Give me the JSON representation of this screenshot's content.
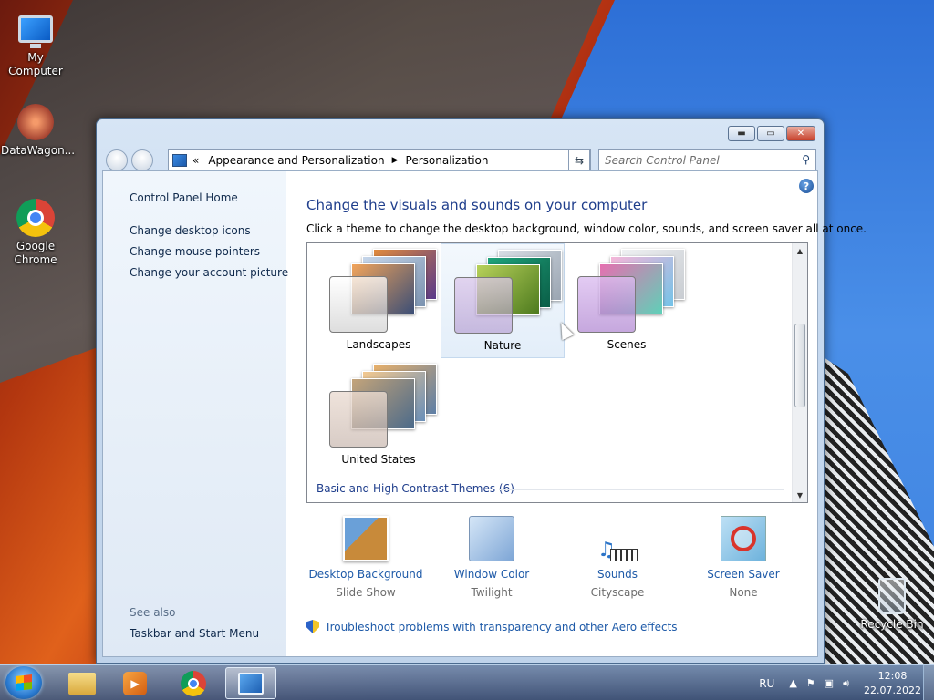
{
  "desktop": {
    "icons": [
      {
        "label": "My Computer",
        "icon": "computer-icon"
      },
      {
        "label": "DataWagon...",
        "icon": "datawagon-icon"
      },
      {
        "label": "Google Chrome",
        "icon": "chrome-icon"
      },
      {
        "label": "Recycle Bin",
        "icon": "recycle-bin-icon"
      }
    ]
  },
  "window": {
    "address": {
      "prefix": "«",
      "crumb1": "Appearance and Personalization",
      "crumb2": "Personalization"
    },
    "search_placeholder": "Search Control Panel",
    "sidebar": {
      "home": "Control Panel Home",
      "links": [
        "Change desktop icons",
        "Change mouse pointers",
        "Change your account picture"
      ],
      "see_also": "See also",
      "see_also_links": [
        "Taskbar and Start Menu"
      ]
    },
    "main": {
      "title": "Change the visuals and sounds on your computer",
      "subtitle": "Click a theme to change the desktop background, window color, sounds, and screen saver all at once.",
      "themes": [
        {
          "name": "Landscapes",
          "selected": false
        },
        {
          "name": "Nature",
          "selected": true
        },
        {
          "name": "Scenes",
          "selected": false
        },
        {
          "name": "United States",
          "selected": false
        }
      ],
      "group_header": "Basic and High Contrast Themes (6)",
      "settings": [
        {
          "label": "Desktop Background",
          "value": "Slide Show",
          "icon": "desktop-background-icon"
        },
        {
          "label": "Window Color",
          "value": "Twilight",
          "icon": "window-color-icon"
        },
        {
          "label": "Sounds",
          "value": "Cityscape",
          "icon": "sounds-icon"
        },
        {
          "label": "Screen Saver",
          "value": "None",
          "icon": "screen-saver-icon"
        }
      ],
      "troubleshoot": "Troubleshoot problems with transparency and other Aero effects"
    }
  },
  "taskbar": {
    "language": "RU",
    "time": "12:08",
    "date": "22.07.2022"
  }
}
